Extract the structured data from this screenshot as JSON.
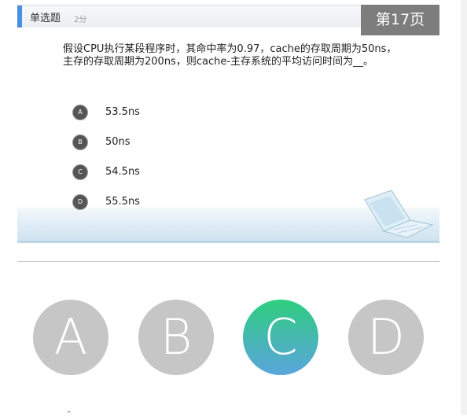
{
  "slide": {
    "question_type": "单选题",
    "score": "2分",
    "page_label": "第17页",
    "question": "假设CPU执行某段程序时，其命中率为0.97，cache的存取周期为50ns，主存的存取周期为200ns，则cache-主存系统的平均访问时间为__。",
    "options": [
      {
        "letter": "A",
        "text": "53.5ns"
      },
      {
        "letter": "B",
        "text": "50ns"
      },
      {
        "letter": "C",
        "text": "54.5ns"
      },
      {
        "letter": "D",
        "text": "55.5ns"
      }
    ],
    "decoration_icon": "laptop-icon"
  },
  "answer_buttons": [
    {
      "label": "A",
      "selected": false
    },
    {
      "label": "B",
      "selected": false
    },
    {
      "label": "C",
      "selected": true
    },
    {
      "label": "D",
      "selected": false
    }
  ],
  "colors": {
    "header_accent": "#4a8fe0",
    "page_badge_bg": "#7d7d7d",
    "answer_unselected": "#c6c6c6",
    "answer_selected_top": "#2ecf7e",
    "answer_selected_bottom": "#5aa6dc"
  }
}
